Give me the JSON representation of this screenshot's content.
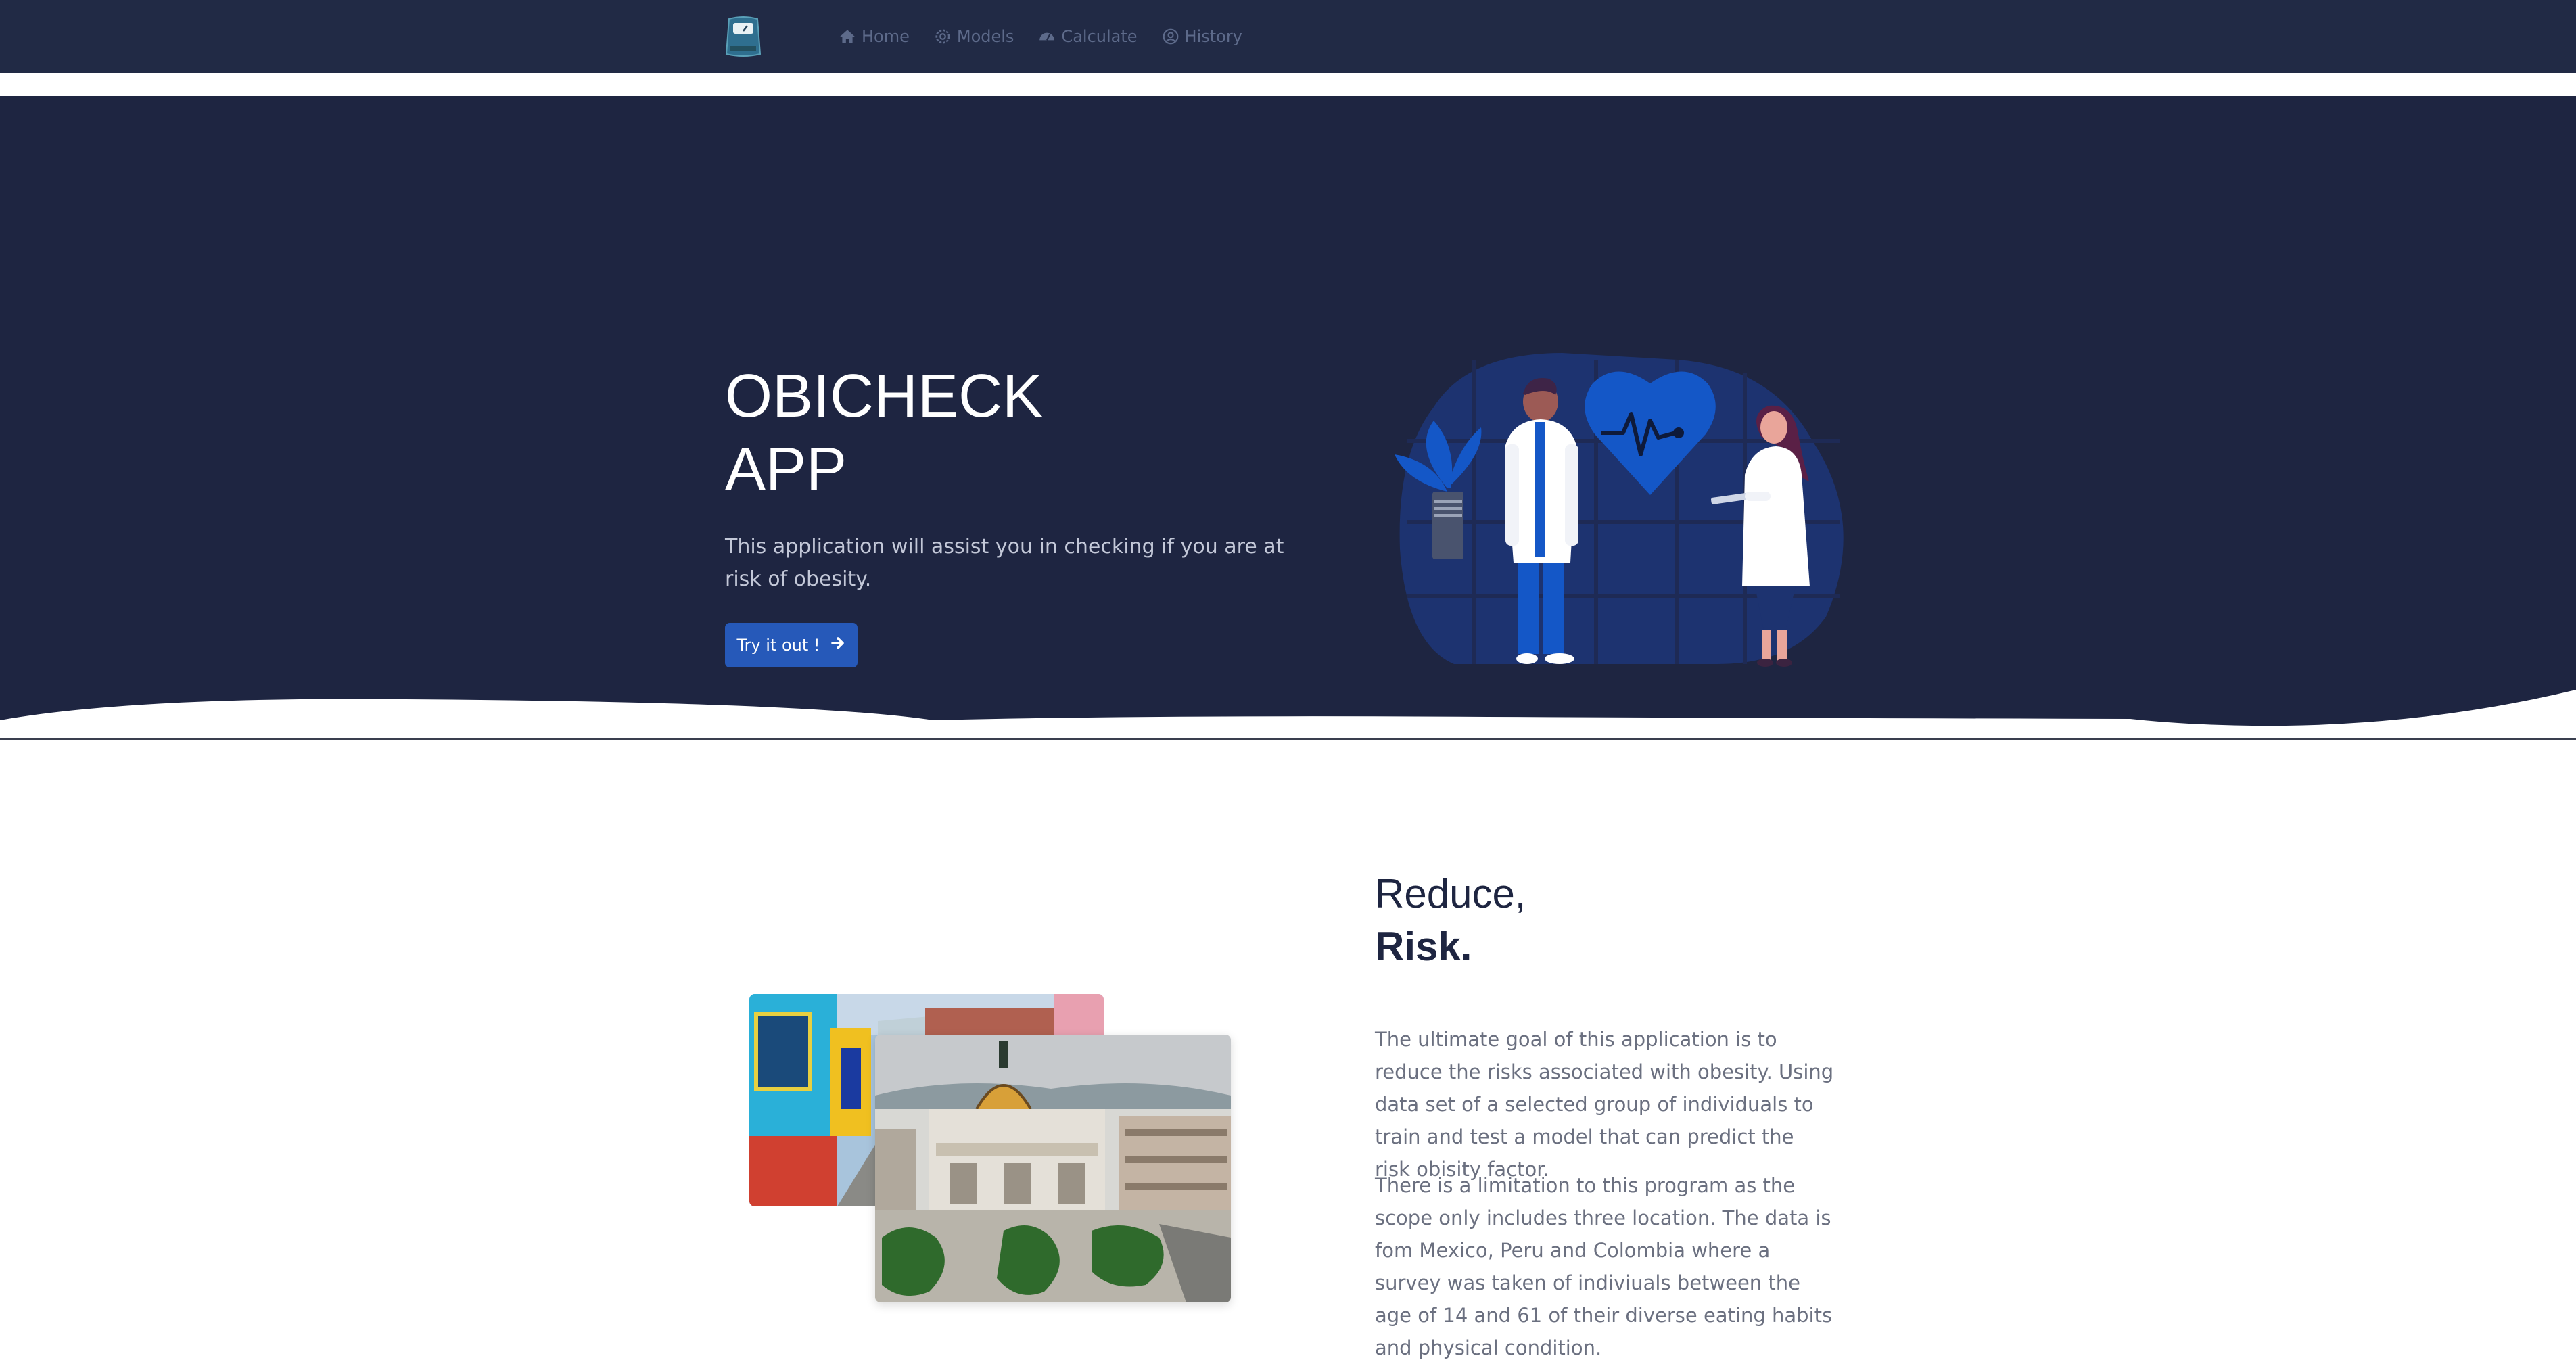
{
  "nav": {
    "logo_icon": "scale-icon",
    "links": [
      {
        "label": "Home",
        "icon": "home-icon"
      },
      {
        "label": "Models",
        "icon": "gear-icon"
      },
      {
        "label": "Calculate",
        "icon": "gauge-icon"
      },
      {
        "label": "History",
        "icon": "user-circle-icon"
      }
    ]
  },
  "hero": {
    "title_line1": "OBICHECK",
    "title_line2": "APP",
    "description": "This application will assist you in checking if you are at risk of obesity.",
    "button_label": "Try it out !",
    "button_icon": "arrow-right-icon",
    "illustration": "doctors-heart-illustration"
  },
  "about": {
    "heading_line1": "Reduce,",
    "heading_line2": "Risk.",
    "paragraph1": "The ultimate goal of this application is to reduce the risks associated with obesity. Using data set of a selected group of individuals to train and test a model that can predict the risk obisity factor.",
    "paragraph2": "There is a limitation to this program as the scope only includes three location. The data is fom Mexico, Peru and Colombia where a survey was taken of indiviuals between the age of 14 and 61 of their diverse eating habits and physical condition."
  },
  "colors": {
    "nav_bg": "#212a45",
    "hero_bg": "#1e2541",
    "button_bg": "#2659b9",
    "accent_blue": "#1457c7"
  }
}
